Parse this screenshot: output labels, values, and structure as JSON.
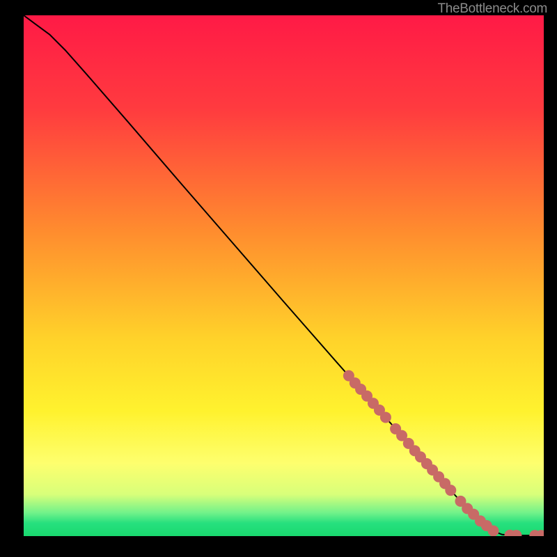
{
  "attribution": "TheBottleneck.com",
  "chart_data": {
    "type": "line",
    "title": "",
    "xlabel": "",
    "ylabel": "",
    "xlim": [
      0,
      100
    ],
    "ylim": [
      0,
      100
    ],
    "gradient_stops": [
      {
        "offset": 0,
        "color": "#ff1a46"
      },
      {
        "offset": 18,
        "color": "#ff3b3f"
      },
      {
        "offset": 42,
        "color": "#ff8e2e"
      },
      {
        "offset": 62,
        "color": "#ffd22a"
      },
      {
        "offset": 76,
        "color": "#fff22e"
      },
      {
        "offset": 86,
        "color": "#feff6e"
      },
      {
        "offset": 92,
        "color": "#d8ff7a"
      },
      {
        "offset": 95.5,
        "color": "#72f28a"
      },
      {
        "offset": 97.5,
        "color": "#27e07e"
      },
      {
        "offset": 100,
        "color": "#19d96f"
      }
    ],
    "curve": [
      {
        "x": 0,
        "y": 100
      },
      {
        "x": 2,
        "y": 98.5
      },
      {
        "x": 5,
        "y": 96.3
      },
      {
        "x": 8,
        "y": 93.3
      },
      {
        "x": 12,
        "y": 88.8
      },
      {
        "x": 20,
        "y": 79.6
      },
      {
        "x": 30,
        "y": 68.0
      },
      {
        "x": 40,
        "y": 56.5
      },
      {
        "x": 50,
        "y": 45.0
      },
      {
        "x": 60,
        "y": 33.6
      },
      {
        "x": 70,
        "y": 22.3
      },
      {
        "x": 78,
        "y": 13.3
      },
      {
        "x": 84,
        "y": 6.7
      },
      {
        "x": 88,
        "y": 2.7
      },
      {
        "x": 90.5,
        "y": 0.9
      },
      {
        "x": 92,
        "y": 0.3
      },
      {
        "x": 94,
        "y": 0.15
      },
      {
        "x": 100,
        "y": 0.12
      }
    ],
    "markers": [
      {
        "x": 62.5,
        "y": 30.8
      },
      {
        "x": 63.7,
        "y": 29.4
      },
      {
        "x": 64.8,
        "y": 28.2
      },
      {
        "x": 66.0,
        "y": 26.9
      },
      {
        "x": 67.2,
        "y": 25.5
      },
      {
        "x": 68.4,
        "y": 24.2
      },
      {
        "x": 69.6,
        "y": 22.8
      },
      {
        "x": 71.5,
        "y": 20.6
      },
      {
        "x": 72.7,
        "y": 19.3
      },
      {
        "x": 74.0,
        "y": 17.8
      },
      {
        "x": 75.2,
        "y": 16.4
      },
      {
        "x": 76.3,
        "y": 15.2
      },
      {
        "x": 77.5,
        "y": 13.9
      },
      {
        "x": 78.6,
        "y": 12.7
      },
      {
        "x": 79.8,
        "y": 11.4
      },
      {
        "x": 81.0,
        "y": 10.1
      },
      {
        "x": 82.1,
        "y": 8.8
      },
      {
        "x": 84.0,
        "y": 6.7
      },
      {
        "x": 85.3,
        "y": 5.3
      },
      {
        "x": 86.5,
        "y": 4.2
      },
      {
        "x": 87.8,
        "y": 2.9
      },
      {
        "x": 89.0,
        "y": 2.0
      },
      {
        "x": 90.3,
        "y": 1.0
      },
      {
        "x": 93.5,
        "y": 0.16
      },
      {
        "x": 94.7,
        "y": 0.14
      },
      {
        "x": 98.3,
        "y": 0.12
      },
      {
        "x": 99.5,
        "y": 0.12
      }
    ],
    "marker_color": "#c86a66",
    "marker_radius": 8
  }
}
